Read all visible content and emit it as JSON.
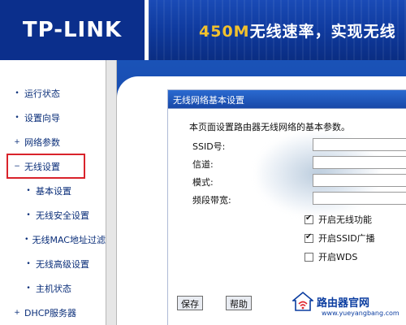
{
  "header": {
    "brand": "TP-LINK",
    "slogan_speed": "450M",
    "slogan_rest": "无线速率，实现无线"
  },
  "sidebar": {
    "items": [
      {
        "label": "运行状态",
        "marker": "•",
        "level": "top"
      },
      {
        "label": "设置向导",
        "marker": "•",
        "level": "top"
      },
      {
        "label": "网络参数",
        "marker": "+",
        "level": "top"
      },
      {
        "label": "无线设置",
        "marker": "−",
        "level": "top",
        "expanded": true
      },
      {
        "label": "基本设置",
        "marker": "•",
        "level": "sub"
      },
      {
        "label": "无线安全设置",
        "marker": "•",
        "level": "sub"
      },
      {
        "label": "无线MAC地址过滤",
        "marker": "•",
        "level": "sub"
      },
      {
        "label": "无线高级设置",
        "marker": "•",
        "level": "sub"
      },
      {
        "label": "主机状态",
        "marker": "•",
        "level": "sub"
      },
      {
        "label": "DHCP服务器",
        "marker": "+",
        "level": "top"
      }
    ]
  },
  "panel": {
    "title": "无线网络基本设置",
    "description": "本页面设置路由器无线网络的基本参数。",
    "fields": {
      "ssid_label": "SSID号:",
      "channel_label": "信道:",
      "mode_label": "模式:",
      "bandwidth_label": "频段带宽:"
    },
    "checkboxes": {
      "wireless": {
        "label": "开启无线功能",
        "checked": true
      },
      "ssid_broadcast": {
        "label": "开启SSID广播",
        "checked": true
      },
      "wds": {
        "label": "开启WDS",
        "checked": false
      }
    },
    "buttons": {
      "save": "保存",
      "help": "帮助"
    }
  },
  "watermark": {
    "big_text": "路由器",
    "site_name": "路由器官网",
    "site_url": "www.yueyangbang.com"
  }
}
